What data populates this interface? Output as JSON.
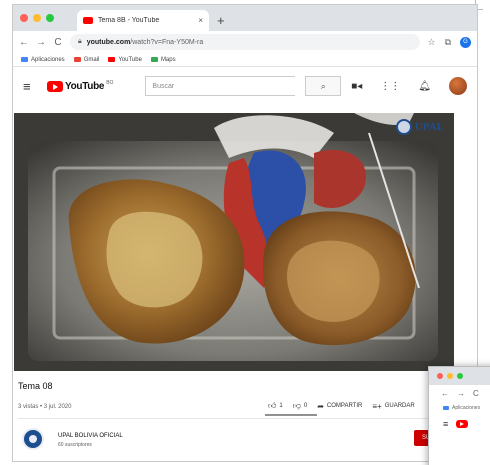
{
  "browser": {
    "tab_title": "Tema 8B - YouTube",
    "tab_close": "×",
    "new_tab": "+",
    "url_host": "youtube.com",
    "url_path": "/watch?v=Fna-Y50M-ra",
    "profile_initial": "G",
    "bookmarks": [
      "Aplicaciones",
      "Gmail",
      "YouTube",
      "Maps"
    ],
    "light_colors": [
      "#ff5f57",
      "#febc2e",
      "#28c840"
    ]
  },
  "youtube": {
    "logo_text": "YouTube",
    "region": "BO",
    "search_placeholder": "Buscar"
  },
  "video": {
    "watermark": "UPAL",
    "title": "Tema 08",
    "meta": "3 vistas • 3 jul. 2020",
    "likes": "1",
    "dislikes": "0",
    "share": "COMPARTIR",
    "save": "GUARDAR"
  },
  "channel": {
    "name": "UPAL BOLIVIA OFICIAL",
    "subscribers": "60 suscriptores",
    "subscribe_label": "SUSCRIBIRME"
  },
  "mini_window": {
    "bookmark": "Aplicaciones"
  },
  "icons": {
    "back": "back-arrow-icon",
    "forward": "forward-arrow-icon",
    "reload": "reload-icon",
    "lock": "lock-icon",
    "star": "star-icon",
    "search": "search-icon",
    "camera": "create-video-icon",
    "apps": "apps-grid-icon",
    "bell": "notifications-icon"
  },
  "colors": {
    "brand": "#ff0000",
    "subscribe": "#cc0000",
    "upal_blue": "#1d4e8f"
  }
}
